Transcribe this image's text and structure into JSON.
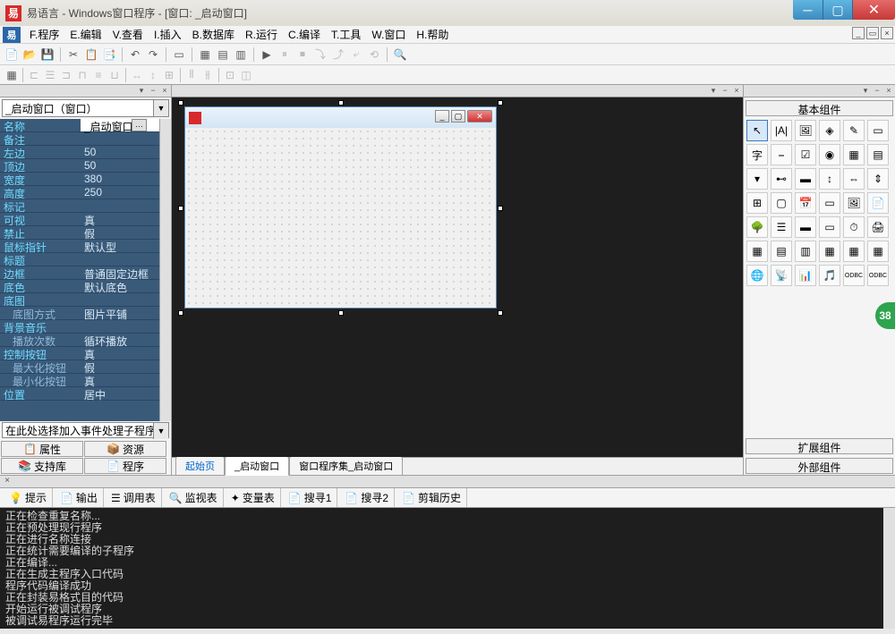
{
  "title": "易语言 - Windows窗口程序 - [窗口: _启动窗口]",
  "menu": [
    "F.程序",
    "E.编辑",
    "V.查看",
    "I.插入",
    "B.数据库",
    "R.运行",
    "C.编译",
    "T.工具",
    "W.窗口",
    "H.帮助"
  ],
  "left": {
    "combo": "_启动窗口（窗口）",
    "props": [
      {
        "n": "名称",
        "v": "_启动窗口",
        "sel": true
      },
      {
        "n": "备注",
        "v": ""
      },
      {
        "n": "左边",
        "v": "50"
      },
      {
        "n": "顶边",
        "v": "50"
      },
      {
        "n": "宽度",
        "v": "380"
      },
      {
        "n": "高度",
        "v": "250"
      },
      {
        "n": "标记",
        "v": ""
      },
      {
        "n": "可视",
        "v": "真"
      },
      {
        "n": "禁止",
        "v": "假"
      },
      {
        "n": "鼠标指针",
        "v": "默认型"
      },
      {
        "n": "标题",
        "v": ""
      },
      {
        "n": "边框",
        "v": "普通固定边框"
      },
      {
        "n": "底色",
        "v": "默认底色"
      },
      {
        "n": "底图",
        "v": ""
      },
      {
        "n": "底图方式",
        "v": "图片平铺",
        "indent": true
      },
      {
        "n": "背景音乐",
        "v": ""
      },
      {
        "n": "播放次数",
        "v": "循环播放",
        "indent": true
      },
      {
        "n": "控制按钮",
        "v": "真"
      },
      {
        "n": "最大化按钮",
        "v": "假",
        "indent": true
      },
      {
        "n": "最小化按钮",
        "v": "真",
        "indent": true
      },
      {
        "n": "位置",
        "v": "居中"
      }
    ],
    "event_placeholder": "在此处选择加入事件处理子程序",
    "buttons": [
      "属性",
      "资源",
      "支持库",
      "程序"
    ]
  },
  "center_tabs": [
    "起始页",
    "_启动窗口",
    "窗口程序集_启动窗口"
  ],
  "right": {
    "sections": [
      "基本组件",
      "扩展组件",
      "外部组件"
    ]
  },
  "bottom": {
    "tabs": [
      "提示",
      "输出",
      "调用表",
      "监视表",
      "变量表",
      "搜寻1",
      "搜寻2",
      "剪辑历史"
    ],
    "output": [
      "正在检查重复名称...",
      "正在预处理现行程序",
      "正在进行名称连接",
      "正在统计需要编译的子程序",
      "正在编译...",
      "正在生成主程序入口代码",
      "程序代码编译成功",
      "正在封装易格式目的代码",
      "开始运行被调试程序",
      "被调试易程序运行完毕"
    ]
  },
  "badge": "38"
}
